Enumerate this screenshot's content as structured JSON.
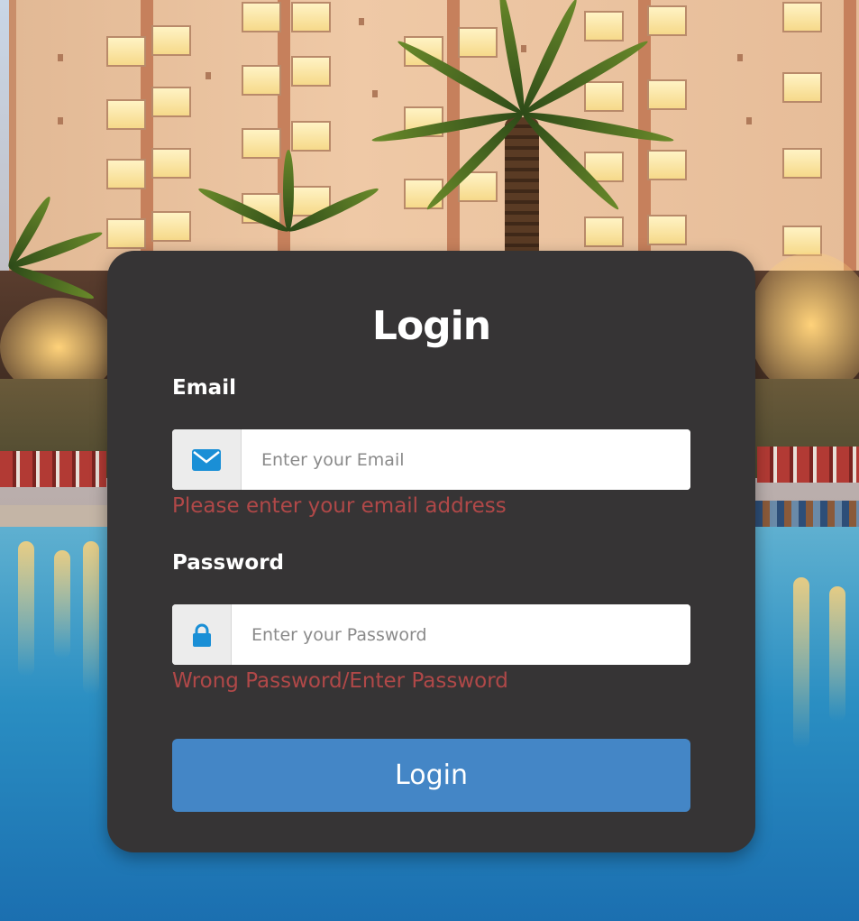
{
  "login_form": {
    "title": "Login",
    "email": {
      "label": "Email",
      "placeholder": "Enter your Email",
      "value": "",
      "icon": "envelope-icon",
      "error": "Please enter your email address"
    },
    "password": {
      "label": "Password",
      "placeholder": "Enter your Password",
      "value": "",
      "icon": "lock-icon",
      "error": "Wrong Password/Enter Password"
    },
    "submit_label": "Login"
  },
  "colors": {
    "card": "#363435",
    "button": "#4486c6",
    "error_text": "#b04848",
    "icon_accent": "#1a8fd6"
  }
}
